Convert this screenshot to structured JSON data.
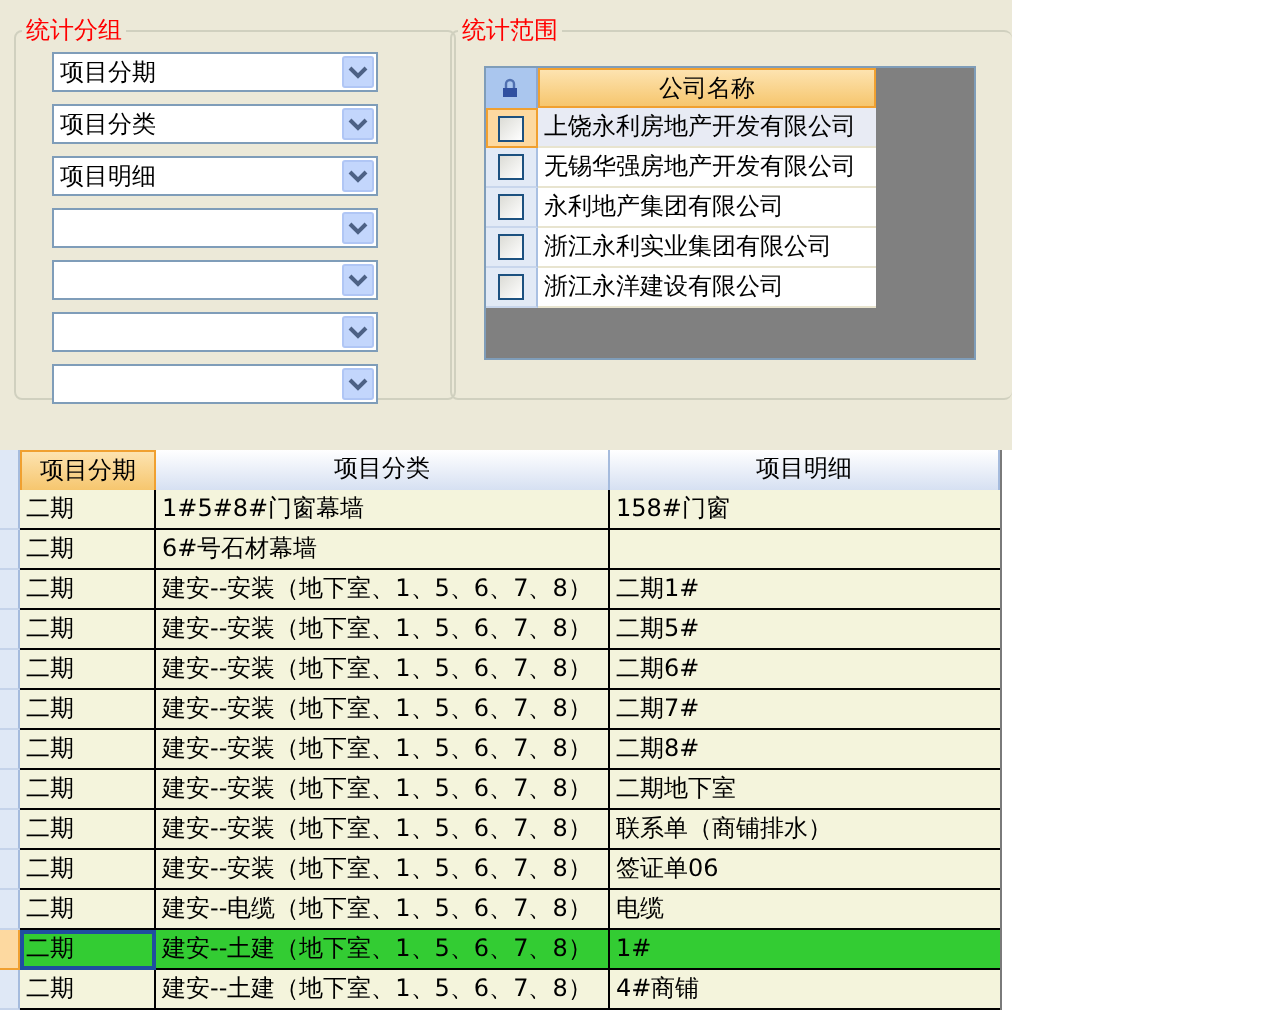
{
  "grouping": {
    "title": "统计分组",
    "selects": [
      {
        "kind": "filled",
        "value": "项目分期"
      },
      {
        "kind": "filled",
        "value": "项目分类"
      },
      {
        "kind": "filled",
        "value": "项目明细"
      },
      {
        "kind": "empty"
      },
      {
        "kind": "empty"
      },
      {
        "kind": "empty"
      },
      {
        "kind": "empty"
      }
    ]
  },
  "scope": {
    "title": "统计范围",
    "column": "公司名称",
    "companies": [
      {
        "name": "上饶永利房地产开发有限公司",
        "checked": false,
        "selected": true
      },
      {
        "name": "无锡华强房地产开发有限公司",
        "checked": false,
        "selected": false
      },
      {
        "name": "永利地产集团有限公司",
        "checked": false,
        "selected": false
      },
      {
        "name": "浙江永利实业集团有限公司",
        "checked": false,
        "selected": false
      },
      {
        "name": "浙江永洋建设有限公司",
        "checked": false,
        "selected": false
      }
    ]
  },
  "table": {
    "columns": [
      {
        "label": "项目分期",
        "selected": true
      },
      {
        "label": "项目分类",
        "selected": false
      },
      {
        "label": "项目明细",
        "selected": false
      }
    ],
    "rows": [
      {
        "period": "二期",
        "category": "1#5#8#门窗幕墙",
        "detail": "158#门窗",
        "selected": false
      },
      {
        "period": "二期",
        "category": "6#号石材幕墙",
        "selected": false
      },
      {
        "period": "二期",
        "category": "建安--安装（地下室、1、5、6、7、8）",
        "detail": "二期1#",
        "selected": false
      },
      {
        "period": "二期",
        "category": "建安--安装（地下室、1、5、6、7、8）",
        "detail": "二期5#",
        "selected": false
      },
      {
        "period": "二期",
        "category": "建安--安装（地下室、1、5、6、7、8）",
        "detail": "二期6#",
        "selected": false
      },
      {
        "period": "二期",
        "category": "建安--安装（地下室、1、5、6、7、8）",
        "detail": "二期7#",
        "selected": false
      },
      {
        "period": "二期",
        "category": "建安--安装（地下室、1、5、6、7、8）",
        "detail": "二期8#",
        "selected": false
      },
      {
        "period": "二期",
        "category": "建安--安装（地下室、1、5、6、7、8）",
        "detail": "二期地下室",
        "selected": false
      },
      {
        "period": "二期",
        "category": "建安--安装（地下室、1、5、6、7、8）",
        "detail": "联系单（商铺排水）",
        "selected": false
      },
      {
        "period": "二期",
        "category": "建安--安装（地下室、1、5、6、7、8）",
        "detail": "签证单06",
        "selected": false
      },
      {
        "period": "二期",
        "category": "建安--电缆（地下室、1、5、6、7、8）",
        "detail": "电缆",
        "selected": false
      },
      {
        "period": "二期",
        "category": "建安--土建（地下室、1、5、6、7、8）",
        "detail": "1#",
        "selected": true
      },
      {
        "period": "二期",
        "category": "建安--土建（地下室、1、5、6、7、8）",
        "detail": "4#商铺",
        "selected": false
      }
    ]
  }
}
